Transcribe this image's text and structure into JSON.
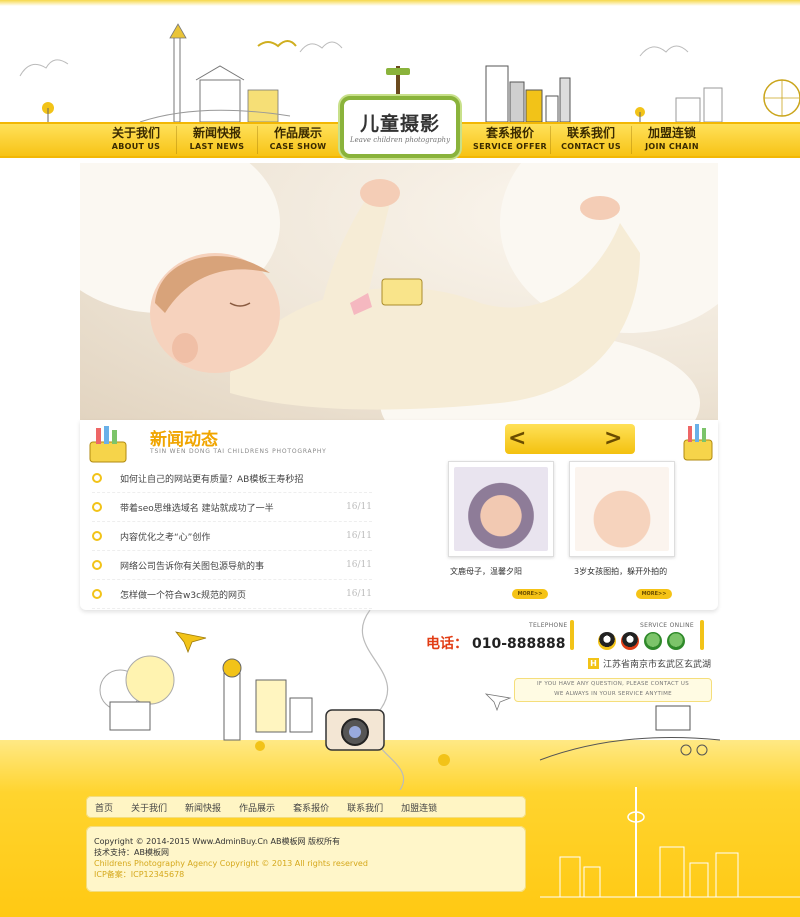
{
  "header": {
    "logo_cn": "儿童摄影",
    "logo_en": "Leave children photography",
    "nav_left": [
      {
        "cn": "关于我们",
        "en": "ABOUT US"
      },
      {
        "cn": "新闻快报",
        "en": "LAST NEWS"
      },
      {
        "cn": "作品展示",
        "en": "CASE SHOW"
      }
    ],
    "nav_right": [
      {
        "cn": "套系报价",
        "en": "SERVICE OFFER"
      },
      {
        "cn": "联系我们",
        "en": "CONTACT US"
      },
      {
        "cn": "加盟连锁",
        "en": "JOIN CHAIN"
      }
    ]
  },
  "news": {
    "title": "新闻动态",
    "subtitle": "TSIN WEN DONG TAI CHILDRENS PHOTOGRAPHY",
    "items": [
      {
        "text": "如何让自己的网站更有质量？AB模板王寿秒招",
        "date": ""
      },
      {
        "text": "带着seo思维选域名 建站就成功了一半",
        "date": "16/11"
      },
      {
        "text": "内容优化之考“心”创作",
        "date": "16/11"
      },
      {
        "text": "网络公司告诉你有关图包源导航的事",
        "date": "16/11"
      },
      {
        "text": "怎样做一个符合w3c规范的网页",
        "date": "16/11"
      }
    ]
  },
  "gallery": {
    "prev": "<",
    "next": ">",
    "photos": [
      {
        "caption": "文鹿母子，温馨夕阳",
        "more": "MORE>>"
      },
      {
        "caption": "3岁女孩图拍，躲开外拍的",
        "more": "MORE>>"
      }
    ]
  },
  "contact": {
    "telephone_label": "TELEPHONE",
    "tel_prefix": "电话：",
    "tel_number": "010-888888",
    "service_label": "SERVICE ONLINE",
    "address_badge": "H",
    "address": "江苏省南京市玄武区玄武湖",
    "note_line1": "IF YOU HAVE ANY QUESTION, PLEASE CONTACT US",
    "note_line2": "WE ALWAYS IN YOUR SERVICE ANYTIME"
  },
  "footer": {
    "nav": [
      "首页",
      "关于我们",
      "新闻快报",
      "作品展示",
      "套系报价",
      "联系我们",
      "加盟连锁"
    ],
    "copyright": "Copyright © 2014-2015 Www.AdminBuy.Cn AB模板网 版权所有",
    "support": "技术支持：AB模板网",
    "en_copyright": "Childrens Photography Agency Copyright © 2013 All rights reserved",
    "icp": "ICP备案：ICP12345678"
  },
  "colors": {
    "accent": "#f2c318",
    "news_title": "#f0a500",
    "telephone": "#e23d15"
  }
}
